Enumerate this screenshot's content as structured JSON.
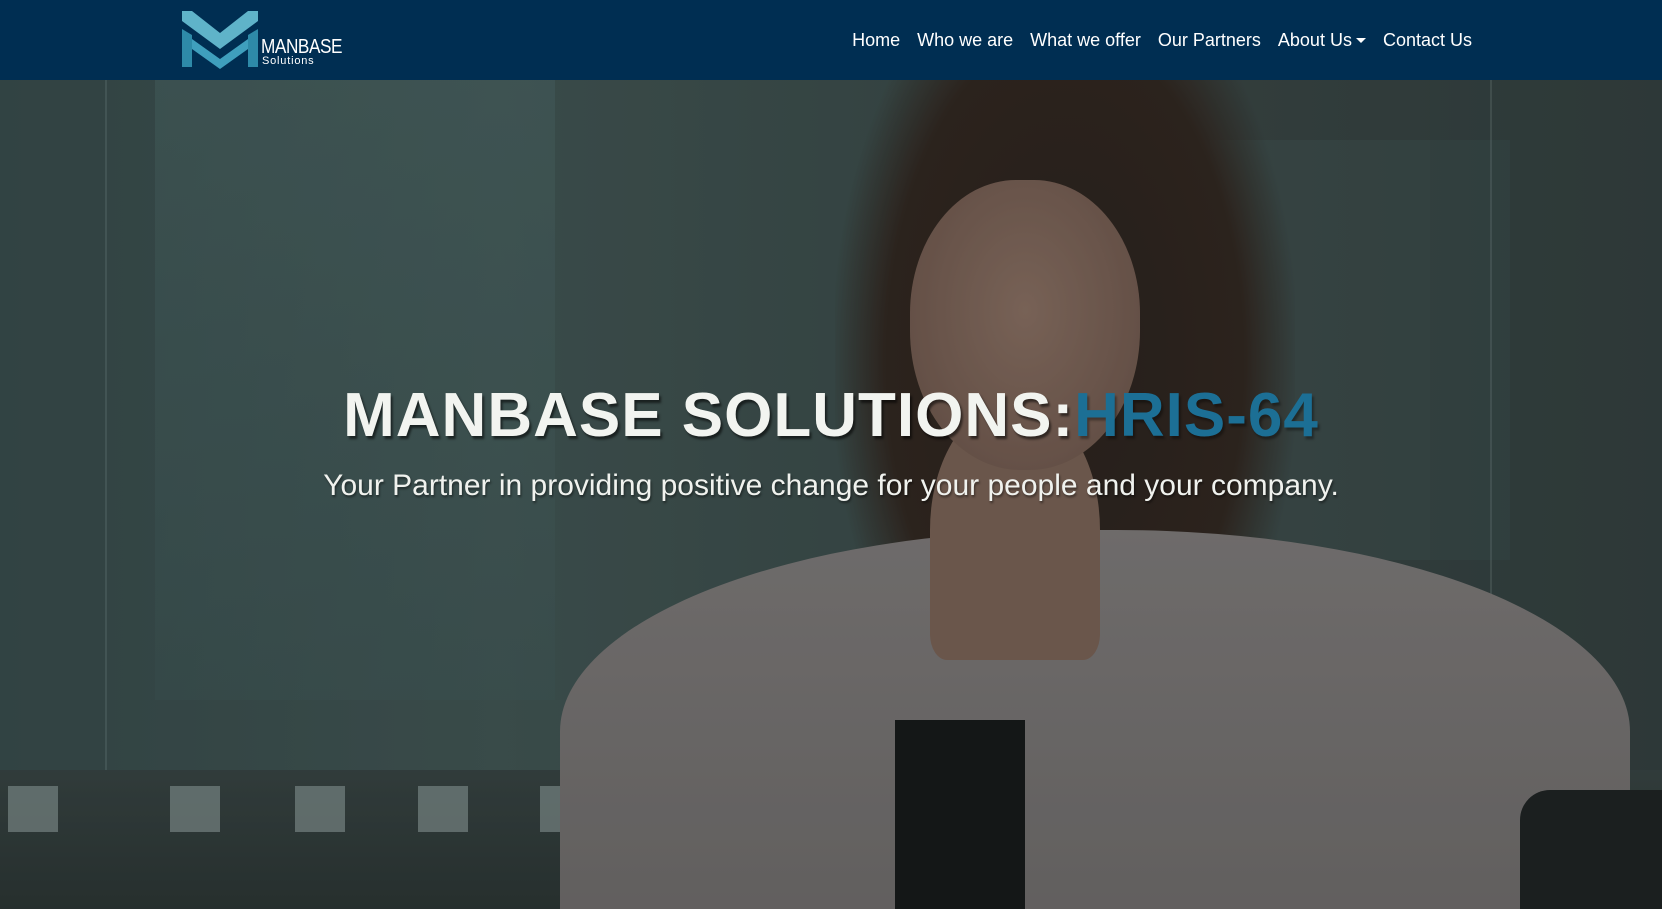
{
  "brand": {
    "name": "MANBASE",
    "tagline": "Solutions",
    "colors": {
      "navbar": "#002e52",
      "logo_light": "#5fb3c9",
      "logo_dark": "#2e8aa8"
    }
  },
  "nav": {
    "items": [
      {
        "label": "Home"
      },
      {
        "label": "Who we are"
      },
      {
        "label": "What we offer"
      },
      {
        "label": "Our Partners"
      },
      {
        "label": "About Us",
        "dropdown": true
      },
      {
        "label": "Contact Us"
      }
    ]
  },
  "hero": {
    "title_main": "MANBASE SOLUTIONS:",
    "title_accent": "HRIS-64",
    "subtitle": "Your Partner in providing positive change for your people and your company.",
    "colors": {
      "accent": "#1c6f95",
      "text": "#f2f4f0"
    }
  }
}
